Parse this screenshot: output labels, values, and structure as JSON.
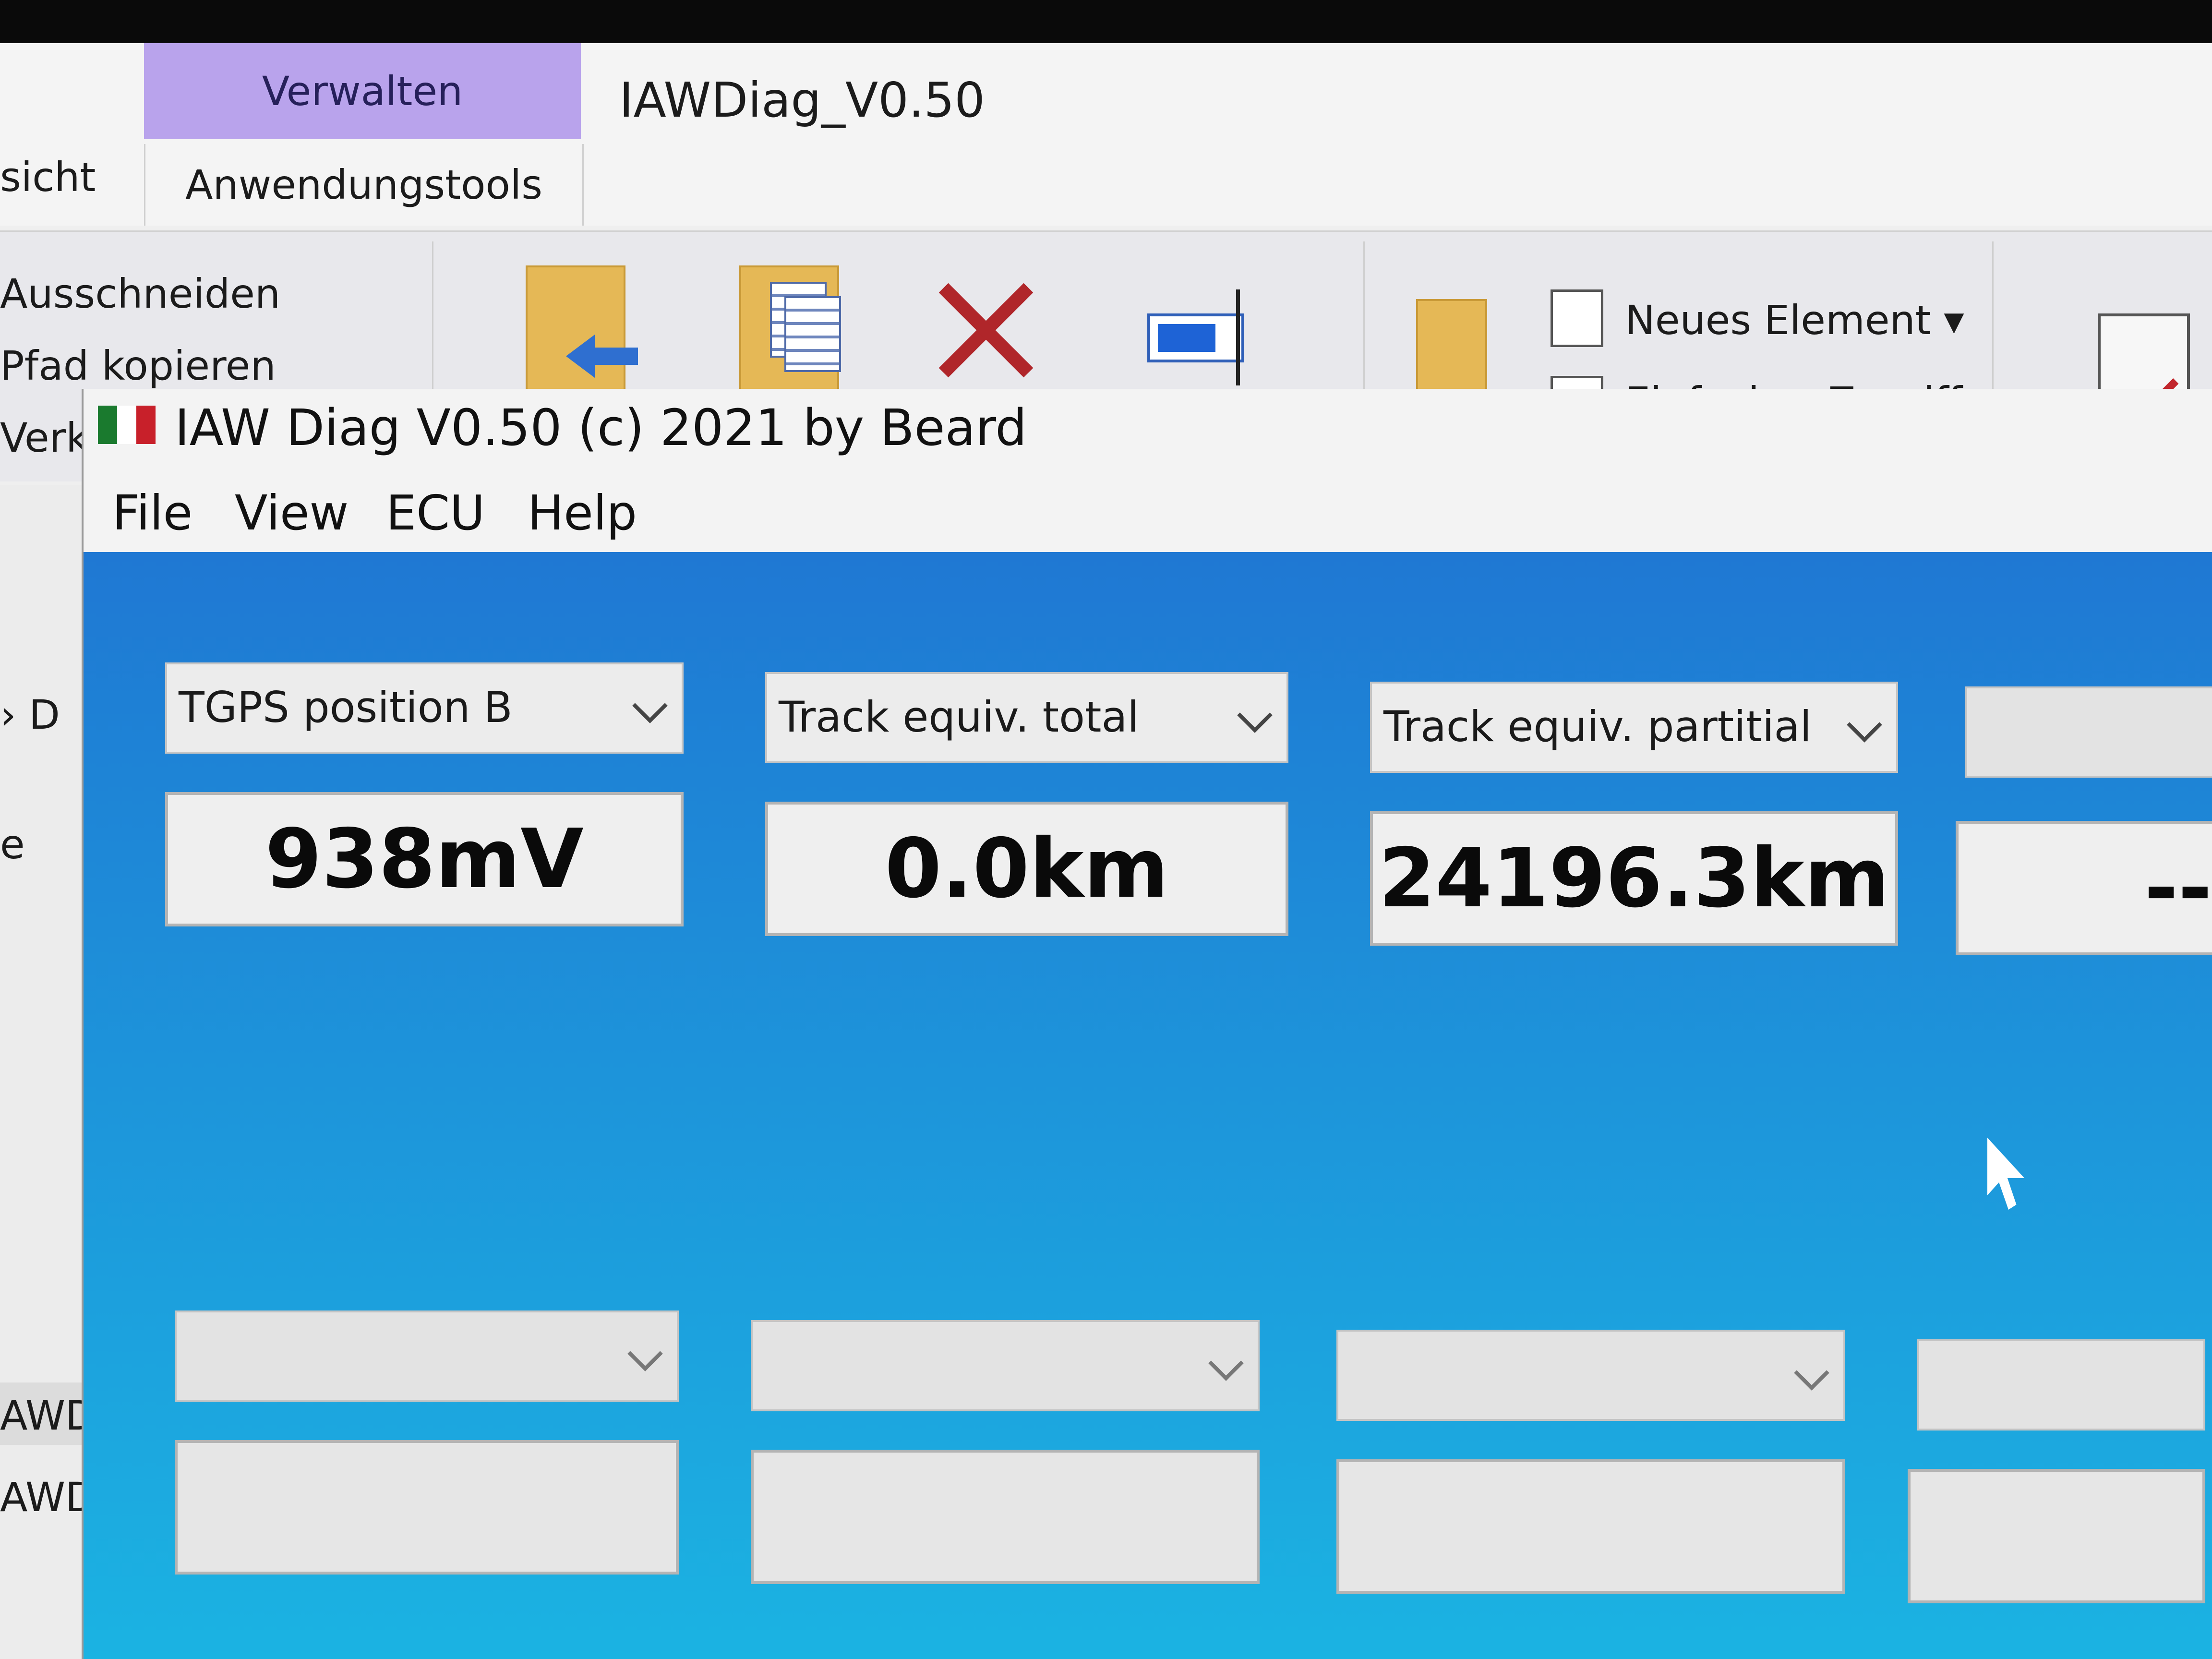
{
  "explorer": {
    "tabs": {
      "ansicht": "sicht",
      "verwalten": "Verwalten",
      "anwendungstools": "Anwendungstools"
    },
    "title": "IAWDiag_V0.50",
    "ribbon": {
      "ausschneiden": "Ausschneiden",
      "pfad_kopieren": "Pfad kopieren",
      "verknuepfung": "Verkn",
      "neues_element": "Neues Element",
      "einfacher_zugriff": "Einfacher Zugriff"
    },
    "left_pane": {
      "item_d": "D",
      "item_e": "e",
      "item_awd1": "AWD",
      "item_awd2": "AWD"
    }
  },
  "iaw": {
    "title": "IAW Diag V0.50  (c) 2021 by Beard",
    "menu": [
      "File",
      "View",
      "ECU",
      "Help"
    ],
    "flag_colors": [
      "#1a7a2e",
      "#ffffff",
      "#c8202a"
    ],
    "slots_top": [
      {
        "label": "TGPS position B",
        "value": "938mV"
      },
      {
        "label": "Track equiv. total",
        "value": "0.0km"
      },
      {
        "label": "Track equiv. partitial",
        "value": "24196.3km"
      },
      {
        "label": "",
        "value": "--"
      }
    ],
    "slots_bottom": [
      {
        "label": "",
        "value": ""
      },
      {
        "label": "",
        "value": ""
      },
      {
        "label": "",
        "value": ""
      },
      {
        "label": "",
        "value": ""
      }
    ]
  },
  "colors": {
    "client_top": "#1f78d3",
    "client_bottom": "#1bb3e2",
    "verwalten_tab": "#b9a3ec"
  }
}
